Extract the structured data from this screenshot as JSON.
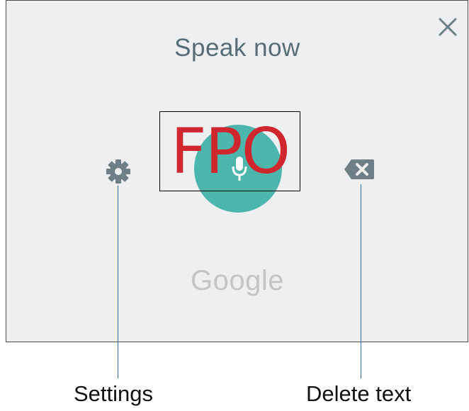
{
  "dialog": {
    "title": "Speak now",
    "logo_text": "Google",
    "placeholder_overlay": "FPO",
    "buttons": {
      "close_icon": "close-icon",
      "settings_icon": "gear-icon",
      "mic_icon": "microphone-icon",
      "delete_icon": "backspace-icon"
    },
    "colors": {
      "panel_background": "#eeeff1",
      "title_text": "#566d77",
      "icon_gray": "#6e7f87",
      "mic_button": "#4db6ac",
      "logo_text": "#c3c4c6",
      "fpo_text": "#d0262e",
      "callout_line": "#2f6da3"
    }
  },
  "callouts": {
    "settings_label": "Settings",
    "delete_label": "Delete text"
  }
}
